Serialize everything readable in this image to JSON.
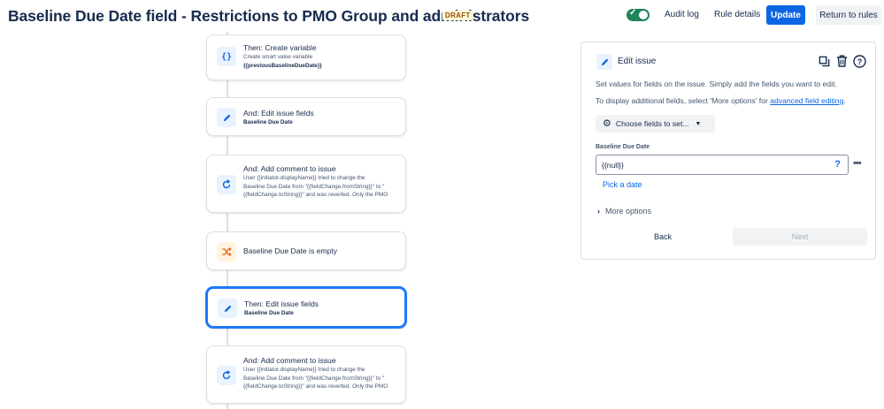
{
  "header": {
    "title": "Baseline Due Date field - Restrictions to PMO Group and administrators",
    "badge": "DRAFT",
    "audit_log": "Audit log",
    "rule_details": "Rule details",
    "update": "Update",
    "return": "Return to rules",
    "toggle_on": true
  },
  "flow": [
    {
      "title": "Then: Create variable",
      "sub1": "Create smart value variable",
      "sub2": "{{previousBaselineDueDate}}",
      "icon": "braces-icon"
    },
    {
      "title": "And: Edit issue fields",
      "sub": "Baseline Due Date",
      "icon": "pencil-icon"
    },
    {
      "title": "And: Add comment to issue",
      "lines": [
        "User {{initiator.displayName}} tried to change the",
        "Baseline Due Date from \"{{fieldChange.fromString}}\" to \"",
        "{{fieldChange.toString}}\" and was reverted. Only the PMO"
      ],
      "icon": "revert-icon"
    },
    {
      "title": "Baseline Due Date is empty",
      "icon": "shuffle-icon"
    },
    {
      "title": "Then: Edit issue fields",
      "sub": "Baseline Due Date",
      "icon": "pencil-icon"
    },
    {
      "title": "And: Add comment to issue",
      "lines": [
        "User {{initiator.displayName}} tried to change the",
        "Baseline Due Date from \"{{fieldChange.fromString}}\" to \"",
        "{{fieldChange.toString}}\" and was reverted. Only the PMO"
      ],
      "icon": "revert-icon"
    }
  ],
  "panel": {
    "title": "Edit issue",
    "desc1": "Set values for fields on the issue. Simply add the fields you want to edit.",
    "desc2_prefix": "To display additional fields, select 'More options' for ",
    "desc2_link": "advanced field editing",
    "desc2_suffix": ".",
    "choose_fields": "Choose fields to set...",
    "field_label": "Baseline Due Date",
    "field_value": "{{null}}",
    "help": "?",
    "more_menu": "•••",
    "pick_date": "Pick a date",
    "more_options": "More options",
    "back": "Back",
    "next": "Next"
  },
  "colors": {
    "primary": "#0c66e4",
    "selected_border": "#1d7afc",
    "toggle_on": "#1f845a",
    "draft_text": "#974f0c",
    "condition_icon": "#e56910"
  }
}
